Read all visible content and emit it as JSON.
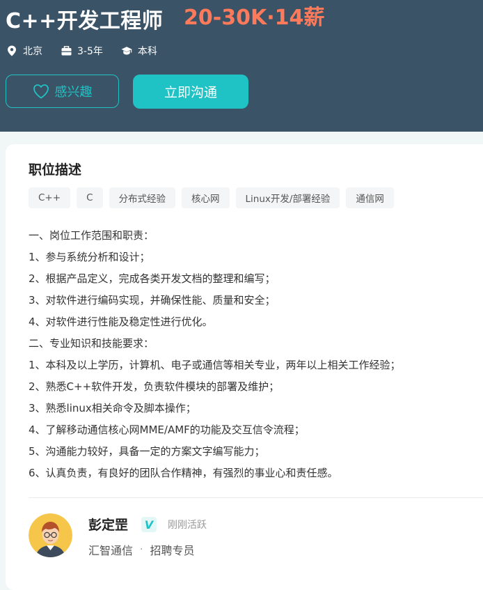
{
  "job": {
    "title": "C++开发工程师",
    "salary": "20-30K·14薪",
    "meta": {
      "city": "北京",
      "experience": "3-5年",
      "degree": "本科"
    },
    "actions": {
      "interest_label": "感兴趣",
      "chat_label": "立即沟通"
    }
  },
  "description": {
    "title": "职位描述",
    "tags": [
      "C++",
      "C",
      "分布式经验",
      "核心网",
      "Linux开发/部署经验",
      "通信网"
    ],
    "lines": [
      "一、岗位工作范围和职责：",
      "1、参与系统分析和设计；",
      "2、根据产品定义，完成各类开发文档的整理和编写；",
      "3、对软件进行编码实现，并确保性能、质量和安全；",
      "4、对软件进行性能及稳定性进行优化。",
      "二、专业知识和技能要求：",
      "1、本科及以上学历，计算机、电子或通信等相关专业，两年以上相关工作经验；",
      "2、熟悉C++软件开发，负责软件模块的部署及维护；",
      "3、熟悉linux相关命令及脚本操作；",
      "4、了解移动通信核心网MME/AMF的功能及交互信令流程；",
      "5、沟通能力较好，具备一定的方案文字编写能力；",
      "6、认真负责，有良好的团队合作精神，有强烈的事业心和责任感。"
    ]
  },
  "recruiter": {
    "name": "彭定罡",
    "verified_mark": "V",
    "status": "刚刚活跃",
    "company": "汇智通信",
    "separator": "·",
    "position": "招聘专员"
  },
  "colors": {
    "header_bg": "#3b5366",
    "accent": "#1fc3c5",
    "salary": "#ff7a5a"
  },
  "icons": {
    "city": "location-pin-icon",
    "experience": "briefcase-icon",
    "degree": "graduation-cap-icon",
    "interest": "heart-icon",
    "verified": "verified-badge-icon"
  }
}
